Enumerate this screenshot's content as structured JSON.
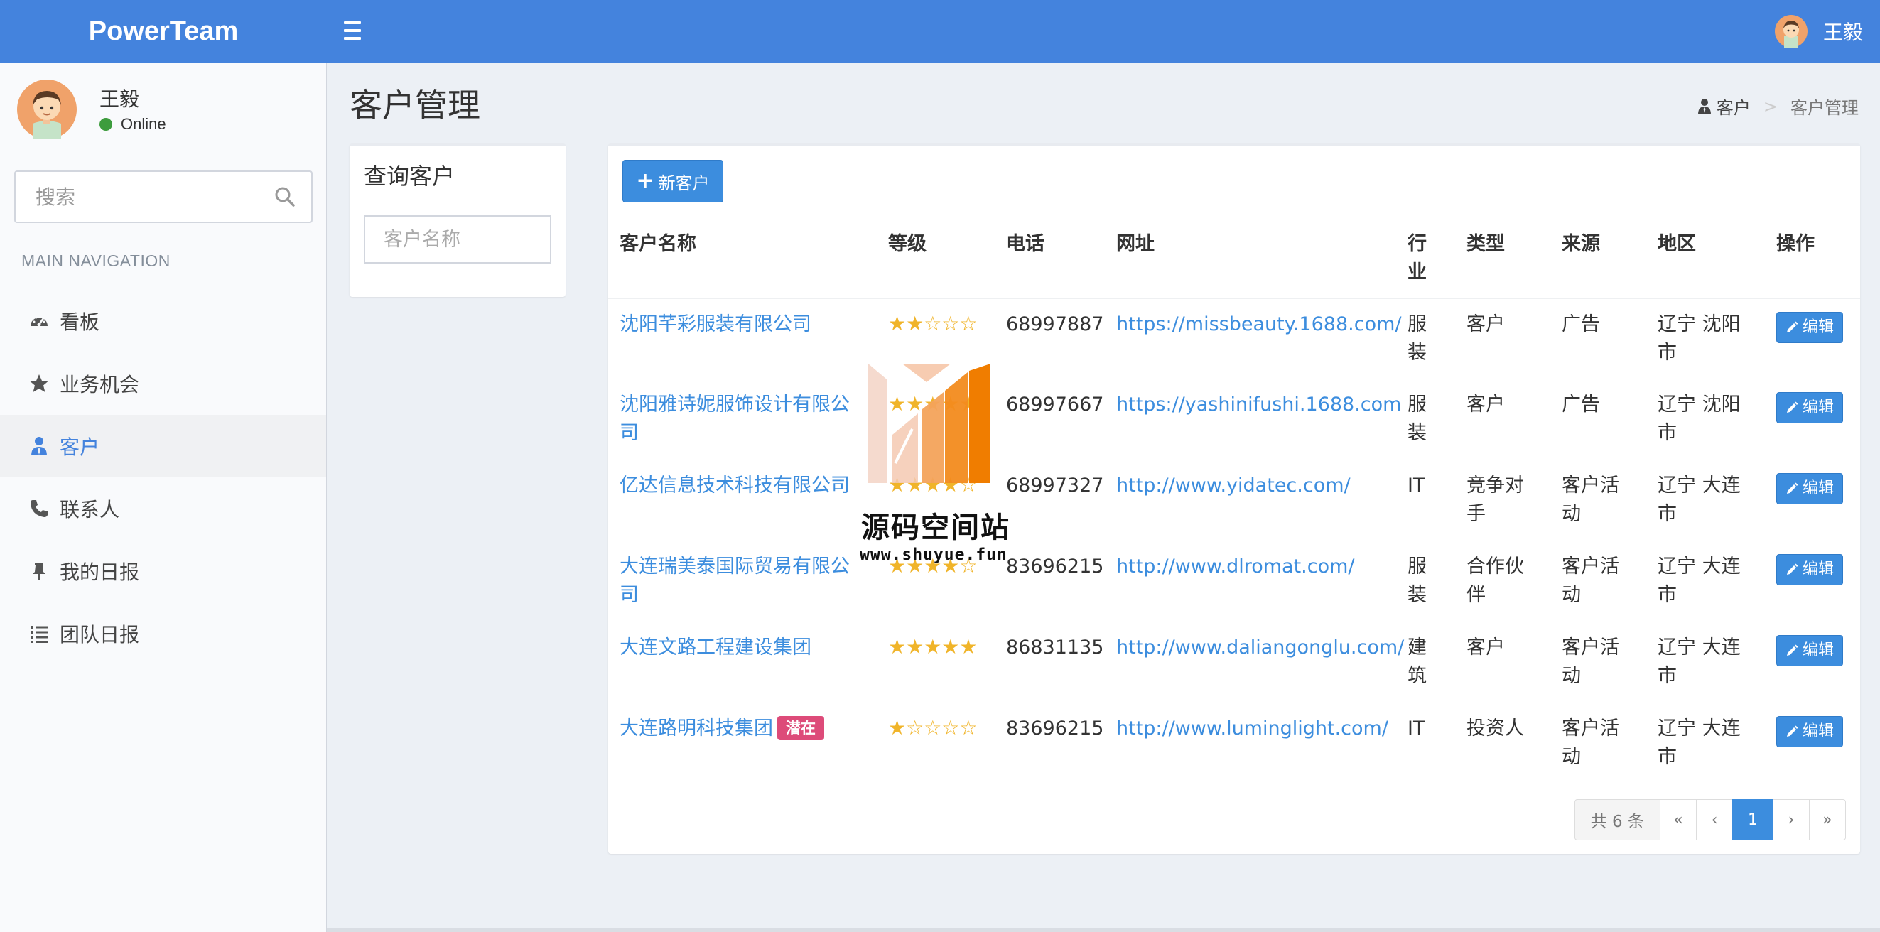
{
  "app": {
    "logo": "PowerTeam"
  },
  "header": {
    "user_name": "王毅"
  },
  "sidebar": {
    "user": {
      "name": "王毅",
      "status": "Online"
    },
    "search": {
      "placeholder": "搜索"
    },
    "nav_header": "MAIN NAVIGATION",
    "items": [
      {
        "label": "看板",
        "icon": "dashboard-icon"
      },
      {
        "label": "业务机会",
        "icon": "star-icon"
      },
      {
        "label": "客户",
        "icon": "user-tie-icon",
        "active": true
      },
      {
        "label": "联系人",
        "icon": "phone-icon"
      },
      {
        "label": "我的日报",
        "icon": "pin-icon"
      },
      {
        "label": "团队日报",
        "icon": "list-icon"
      }
    ]
  },
  "page": {
    "title": "客户管理",
    "breadcrumb": {
      "parent": "客户",
      "separator": ">",
      "current": "客户管理"
    }
  },
  "query": {
    "title": "查询客户",
    "name_placeholder": "客户名称"
  },
  "toolbar": {
    "new_label": "新客户"
  },
  "table": {
    "headers": [
      "客户名称",
      "等级",
      "电话",
      "网址",
      "行业",
      "类型",
      "来源",
      "地区",
      "操作"
    ],
    "edit_label": "编辑",
    "rows": [
      {
        "name": "沈阳芊彩服装有限公司",
        "tag": "",
        "stars": "★★☆☆☆",
        "phone": "68997887",
        "url": "https://missbeauty.1688.com/",
        "industry": "服装",
        "type": "客户",
        "source": "广告",
        "region": "辽宁 沈阳市"
      },
      {
        "name": "沈阳雅诗妮服饰设计有限公司",
        "tag": "",
        "stars": "★★★★★",
        "phone": "68997667",
        "url": "https://yashinifushi.1688.com",
        "industry": "服装",
        "type": "客户",
        "source": "广告",
        "region": "辽宁 沈阳市"
      },
      {
        "name": "亿达信息技术科技有限公司",
        "tag": "",
        "stars": "★★★★☆",
        "phone": "68997327",
        "url": "http://www.yidatec.com/",
        "industry": "IT",
        "type": "竞争对手",
        "source": "客户活动",
        "region": "辽宁 大连市"
      },
      {
        "name": "大连瑞美泰国际贸易有限公司",
        "tag": "",
        "stars": "★★★★☆",
        "phone": "83696215",
        "url": "http://www.dlromat.com/",
        "industry": "服装",
        "type": "合作伙伴",
        "source": "客户活动",
        "region": "辽宁 大连市"
      },
      {
        "name": "大连文路工程建设集团",
        "tag": "",
        "stars": "★★★★★",
        "phone": "86831135",
        "url": "http://www.daliangonglu.com/",
        "industry": "建筑",
        "type": "客户",
        "source": "客户活动",
        "region": "辽宁 大连市"
      },
      {
        "name": "大连路明科技集团",
        "tag": "潜在",
        "stars": "★☆☆☆☆",
        "phone": "83696215",
        "url": "http://www.luminglight.com/",
        "industry": "IT",
        "type": "投资人",
        "source": "客户活动",
        "region": "辽宁 大连市"
      }
    ]
  },
  "pagination": {
    "total": "共 6 条",
    "first": "«",
    "prev": "‹",
    "current": "1",
    "next": "›",
    "last": "»"
  },
  "watermark": {
    "title": "源码空间站",
    "url": "www.shuyue.fun"
  },
  "colors": {
    "primary": "#4483dd",
    "button": "#3c8dde",
    "star": "#f0b429",
    "tag": "#dd4b79",
    "online": "#3d9c3d"
  }
}
